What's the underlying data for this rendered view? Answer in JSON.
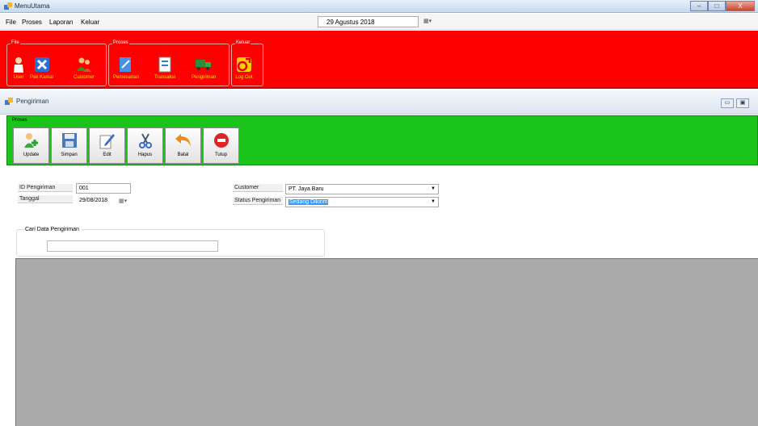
{
  "window": {
    "title": "MenuUtama",
    "controls": [
      "–",
      "□",
      "X"
    ]
  },
  "menu": {
    "items": [
      "File",
      "Proses",
      "Laporan",
      "Keluar"
    ]
  },
  "top_date": {
    "value": "29  Agustus  2018"
  },
  "ribbon": {
    "groups": [
      {
        "label": "File",
        "buttons": [
          "User",
          "Pak Kamar",
          "Customer"
        ]
      },
      {
        "label": "Proses",
        "buttons": [
          "Pemesanan",
          "Transaksi",
          "Pengiriman"
        ]
      },
      {
        "label": "Keluar",
        "buttons": [
          "Log Out"
        ]
      }
    ]
  },
  "child_window": {
    "title": "Pengiriman",
    "controls": [
      "▭",
      "▣"
    ]
  },
  "toolbar": {
    "group_label": "Proses",
    "buttons": [
      "Update",
      "Simpan",
      "Edit",
      "Hapus",
      "Batal",
      "Tutup"
    ]
  },
  "form": {
    "id_label": "ID Pengiriman",
    "id_value": "001",
    "tanggal_label": "Tanggal",
    "tanggal_value": "29/08/2018",
    "customer_label": "Customer",
    "customer_value": "PT. Jaya Baru",
    "status_label": "Status Pengiriman",
    "status_value": "Sedang Dikirim"
  },
  "search": {
    "group_label": "Cari Data Pengiriman",
    "value": ""
  },
  "colors": {
    "ribbon": "#ff0000",
    "toolbar": "#1ac41a",
    "grid": "#ababab",
    "selection": "#3399ff"
  }
}
